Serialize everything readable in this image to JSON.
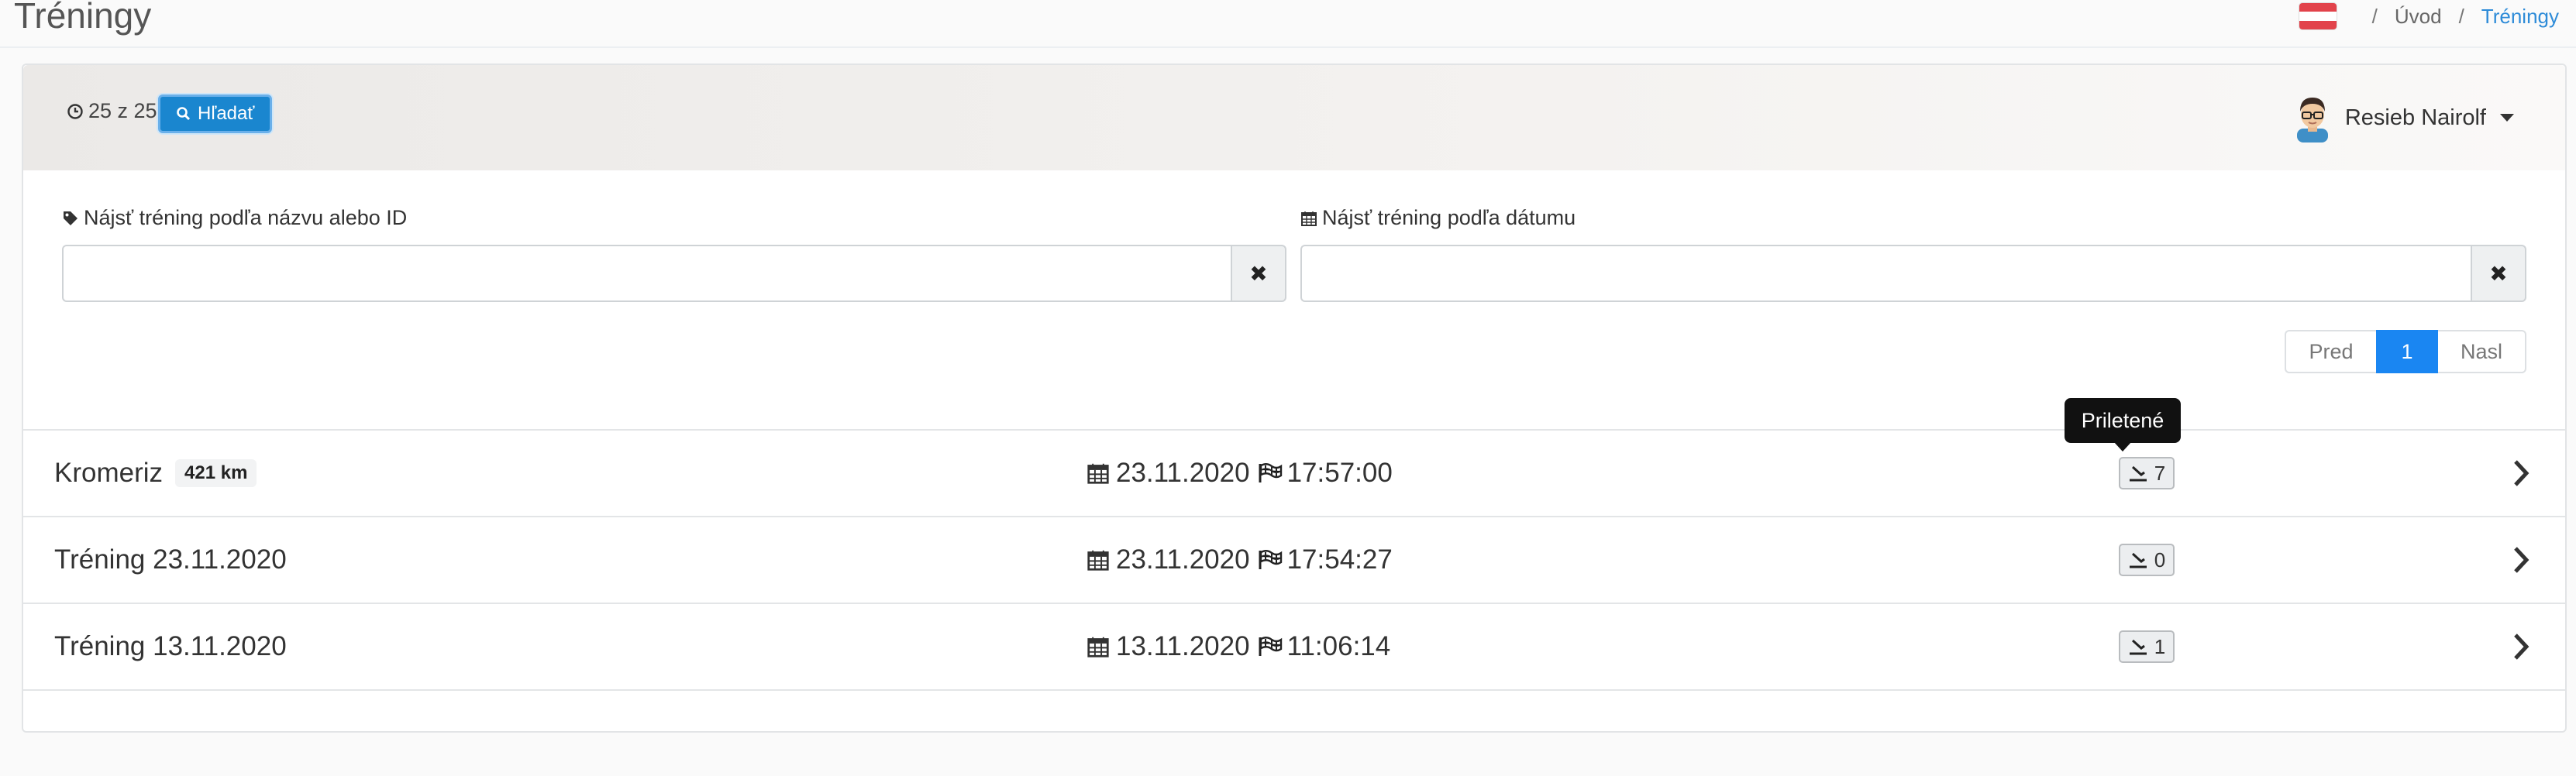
{
  "header": {
    "title": "Tréningy",
    "breadcrumb": {
      "home": "Úvod",
      "separator": "/",
      "current": "Tréningy"
    },
    "flag_icon": "flag-austria-icon"
  },
  "toolbar": {
    "counter_text": "25 z 25",
    "search_label": "Hľadať"
  },
  "user": {
    "name": "Resieb Nairolf"
  },
  "filters": {
    "name_label": "Nájsť tréning podľa názvu alebo ID",
    "name_value": "",
    "date_label": "Nájsť tréning podľa dátumu",
    "date_value": "",
    "clear_symbol": "✖"
  },
  "pagination": {
    "prev": "Pred",
    "current": "1",
    "next": "Nasl"
  },
  "tooltip": {
    "text": "Priletené"
  },
  "trainings": [
    {
      "name": "Kromeriz",
      "distance": "421 km",
      "date": "23.11.2020",
      "time": "17:57:00",
      "arrived": "7"
    },
    {
      "name": "Tréning 23.11.2020",
      "distance": "",
      "date": "23.11.2020",
      "time": "17:54:27",
      "arrived": "0"
    },
    {
      "name": "Tréning 13.11.2020",
      "distance": "",
      "date": "13.11.2020",
      "time": "11:06:14",
      "arrived": "1"
    }
  ],
  "colors": {
    "primary": "#1a86cf",
    "active_page": "#1a86f2",
    "breadcrumb_active": "#2d8bd8"
  }
}
